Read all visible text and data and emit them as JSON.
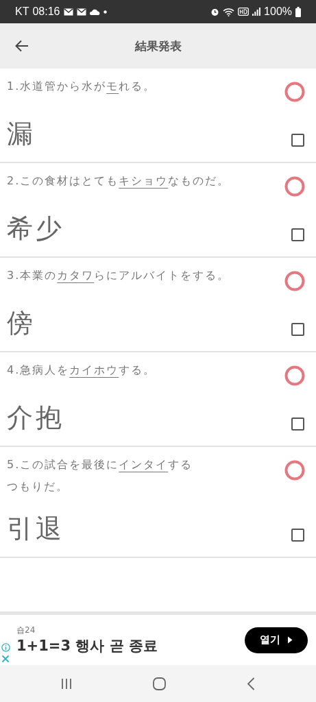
{
  "status_bar": {
    "carrier": "KT",
    "time": "08:16",
    "battery": "100%"
  },
  "app_bar": {
    "title": "結果発表"
  },
  "questions": [
    {
      "before": "1.水道管から水が",
      "target": "モ",
      "after": "れる。",
      "answer": "漏",
      "correct": true,
      "checked": false
    },
    {
      "before": "2.この食材はとても",
      "target": "キショウ",
      "after": "なものだ。",
      "answer": "希少",
      "correct": true,
      "checked": false
    },
    {
      "before": "3.本業の",
      "target": "カタワ",
      "after": "らにアルバイトをする。",
      "answer": "傍",
      "correct": true,
      "checked": false
    },
    {
      "before": "4.急病人を",
      "target": "カイホウ",
      "after": "する。",
      "answer": "介抱",
      "correct": true,
      "checked": false
    },
    {
      "before": "5.この試合を最後に",
      "target": "インタイ",
      "after": "する",
      "line_2": "つもりだ。",
      "answer": "引退",
      "correct": true,
      "checked": false
    }
  ],
  "ad": {
    "advertiser": "숍24",
    "headline": "1+1=3 행사 곧 종료",
    "button": "열기"
  }
}
